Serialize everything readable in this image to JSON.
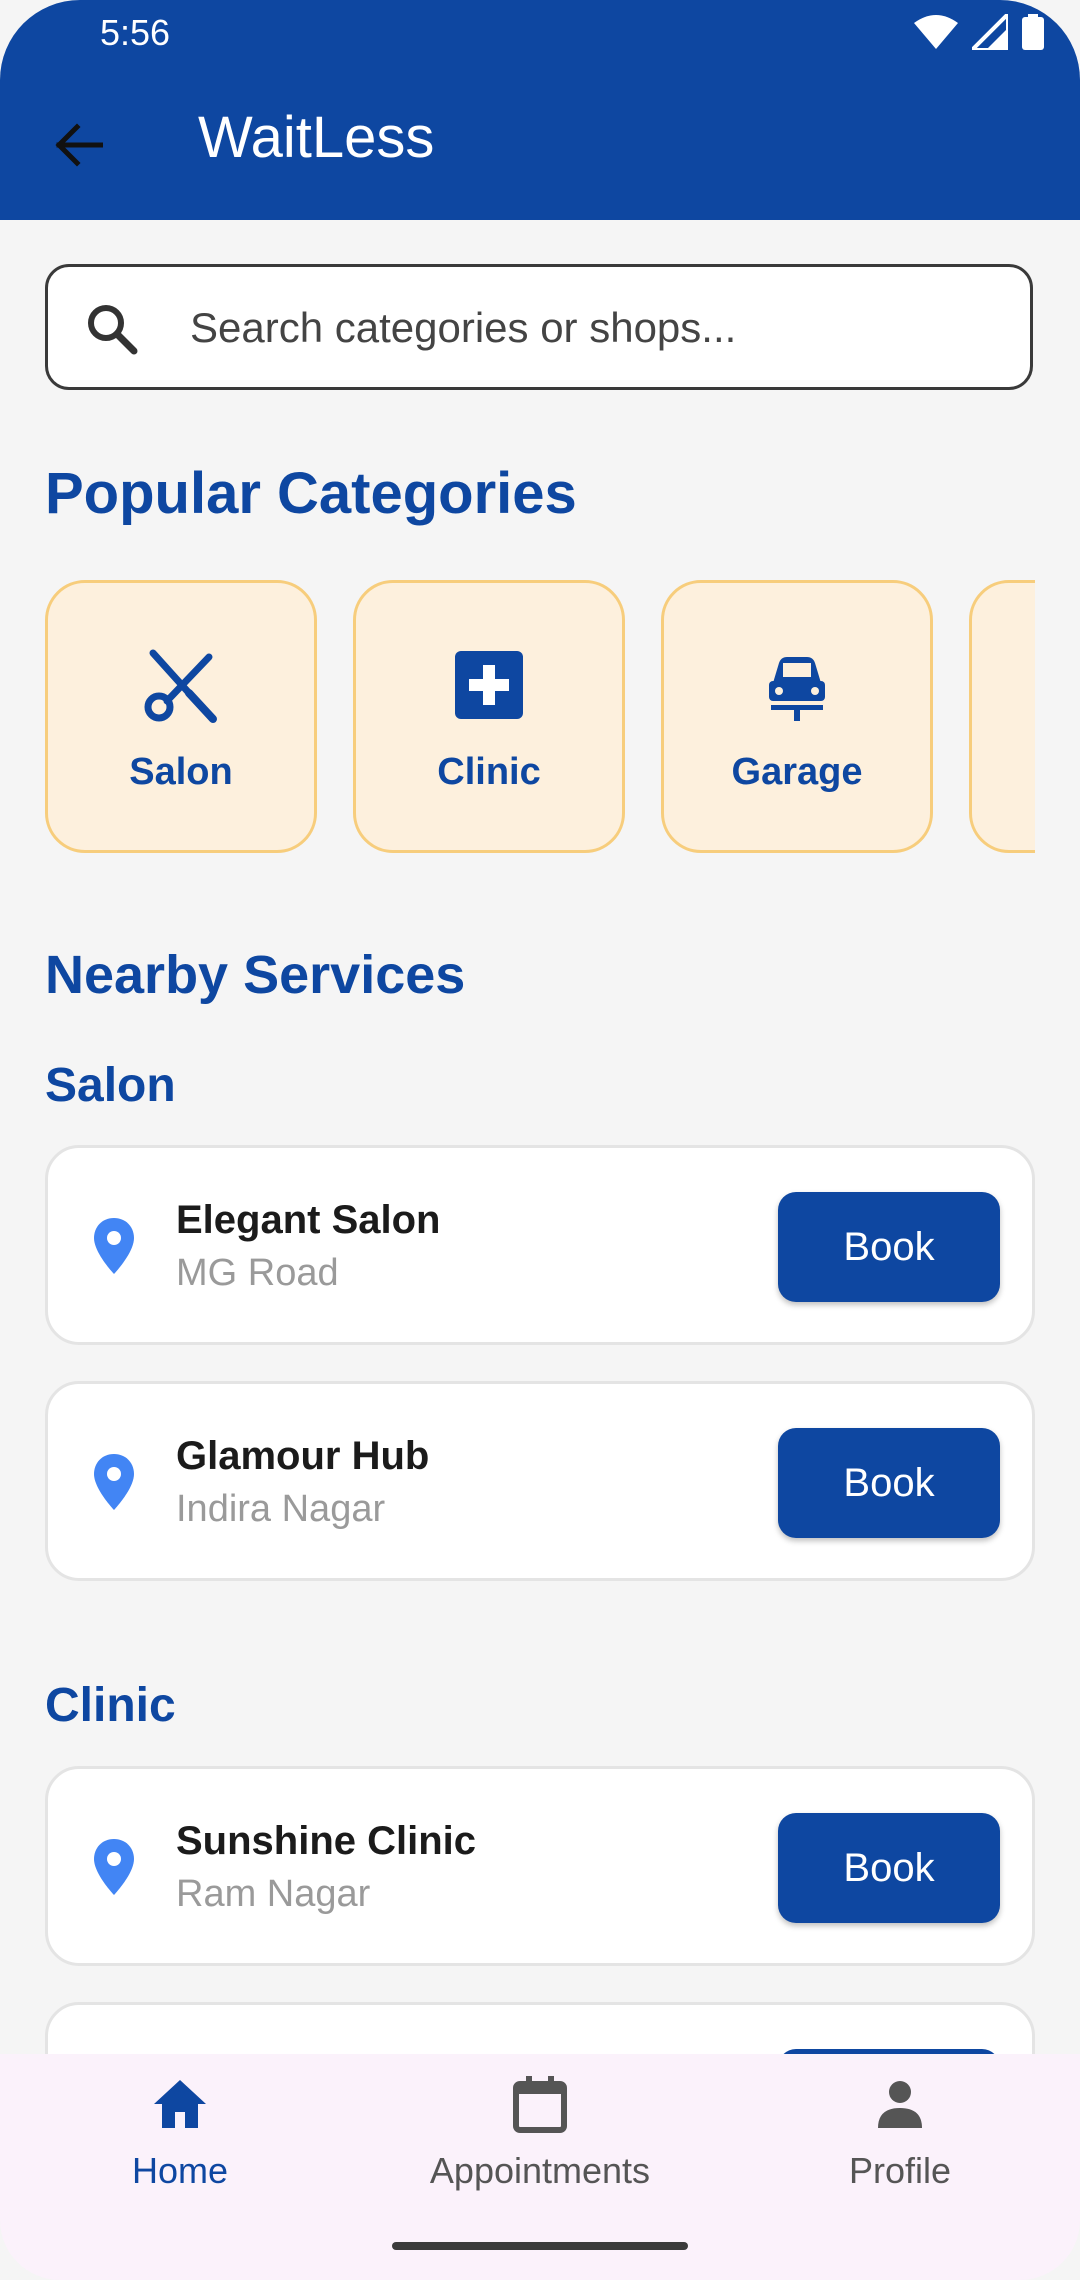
{
  "status": {
    "time": "5:56"
  },
  "app": {
    "title": "WaitLess"
  },
  "search": {
    "placeholder": "Search categories or shops..."
  },
  "sections": {
    "popular": "Popular Categories",
    "nearby": "Nearby Services"
  },
  "categories": [
    {
      "label": "Salon",
      "icon": "scissors-icon"
    },
    {
      "label": "Clinic",
      "icon": "medical-plus-icon"
    },
    {
      "label": "Garage",
      "icon": "car-icon"
    }
  ],
  "groups": [
    {
      "title": "Salon",
      "shops": [
        {
          "name": "Elegant Salon",
          "location": "MG Road",
          "action": "Book"
        },
        {
          "name": "Glamour Hub",
          "location": "Indira Nagar",
          "action": "Book"
        }
      ]
    },
    {
      "title": "Clinic",
      "shops": [
        {
          "name": "Sunshine Clinic",
          "location": "Ram Nagar",
          "action": "Book"
        }
      ]
    }
  ],
  "nav": [
    {
      "label": "Home",
      "icon": "home-icon",
      "active": true
    },
    {
      "label": "Appointments",
      "icon": "calendar-icon",
      "active": false
    },
    {
      "label": "Profile",
      "icon": "person-icon",
      "active": false
    }
  ],
  "colors": {
    "primary": "#0e47a1",
    "category_bg": "#fdf0dd",
    "category_border": "#f7cd7c",
    "pin": "#4285f4",
    "nav_bg": "#fbf2fb"
  }
}
